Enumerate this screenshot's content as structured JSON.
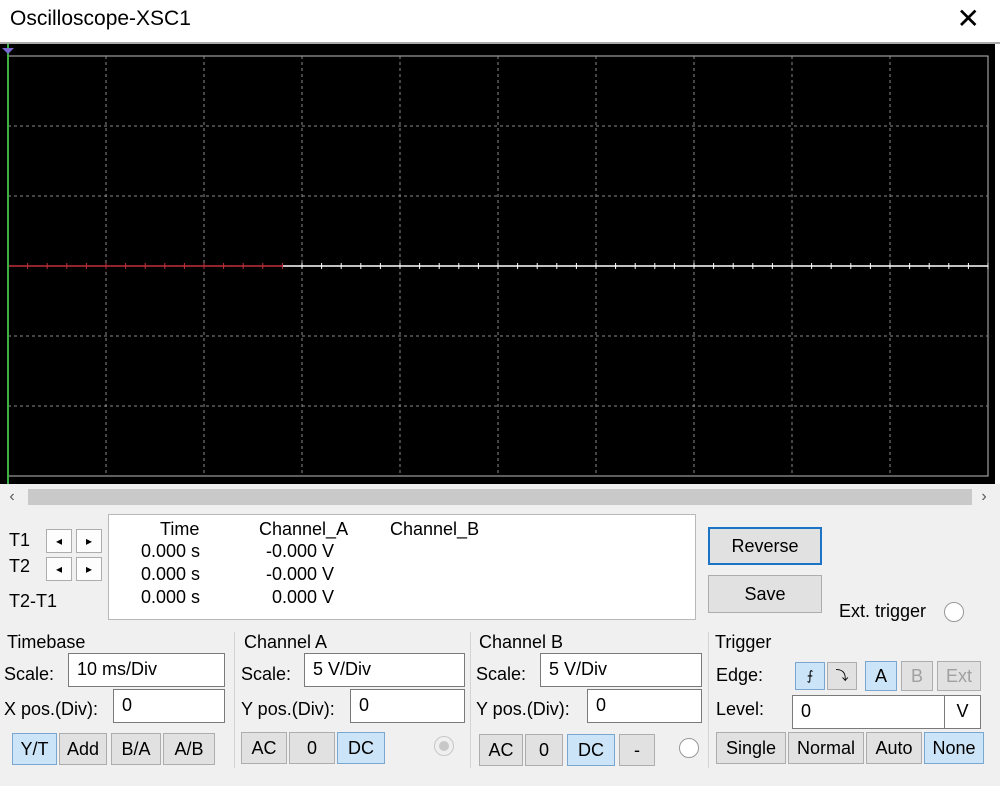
{
  "window": {
    "title": "Oscilloscope-XSC1",
    "close_symbol": "✕"
  },
  "scrollbar": {
    "left_arrow": "‹",
    "right_arrow": "›"
  },
  "cursors": {
    "t1": "T1",
    "t2": "T2",
    "diff": "T2-T1",
    "left": "◂",
    "right": "▸"
  },
  "readout": {
    "headers": [
      "Time",
      "Channel_A",
      "Channel_B"
    ],
    "rows": [
      {
        "time": "0.000 s",
        "a": "-0.000 V"
      },
      {
        "time": "0.000 s",
        "a": "-0.000 V"
      },
      {
        "time": "0.000 s",
        "a": "0.000 V"
      }
    ]
  },
  "buttons": {
    "reverse": "Reverse",
    "save": "Save",
    "ext_trigger": "Ext. trigger"
  },
  "timebase": {
    "title": "Timebase",
    "scale_label": "Scale:",
    "scale": "10 ms/Div",
    "xpos_label": "X pos.(Div):",
    "xpos": "0",
    "modes": [
      "Y/T",
      "Add",
      "B/A",
      "A/B"
    ],
    "selected_mode": "Y/T"
  },
  "channel_a": {
    "title": "Channel A",
    "scale_label": "Scale:",
    "scale": "5  V/Div",
    "ypos_label": "Y pos.(Div):",
    "ypos": "0",
    "coupling": [
      "AC",
      "0",
      "DC"
    ],
    "selected_coupling": "DC"
  },
  "channel_b": {
    "title": "Channel B",
    "scale_label": "Scale:",
    "scale": "5  V/Div",
    "ypos_label": "Y pos.(Div):",
    "ypos": "0",
    "coupling": [
      "AC",
      "0",
      "DC",
      "-"
    ],
    "selected_coupling": "DC"
  },
  "trigger": {
    "title": "Trigger",
    "edge_label": "Edge:",
    "edge_rise": "⨍",
    "edge_fall": "⤵",
    "sources": [
      "A",
      "B",
      "Ext"
    ],
    "selected_source": "A",
    "level_label": "Level:",
    "level": "0",
    "level_unit": "V",
    "modes": [
      "Single",
      "Normal",
      "Auto",
      "None"
    ],
    "selected_mode": "None"
  },
  "colors": {
    "screen": "#000000",
    "grid": "#8a8a8a",
    "trace_a": "#c0303c",
    "trace_b": "#ffffff",
    "selected": "#cce4f7"
  }
}
